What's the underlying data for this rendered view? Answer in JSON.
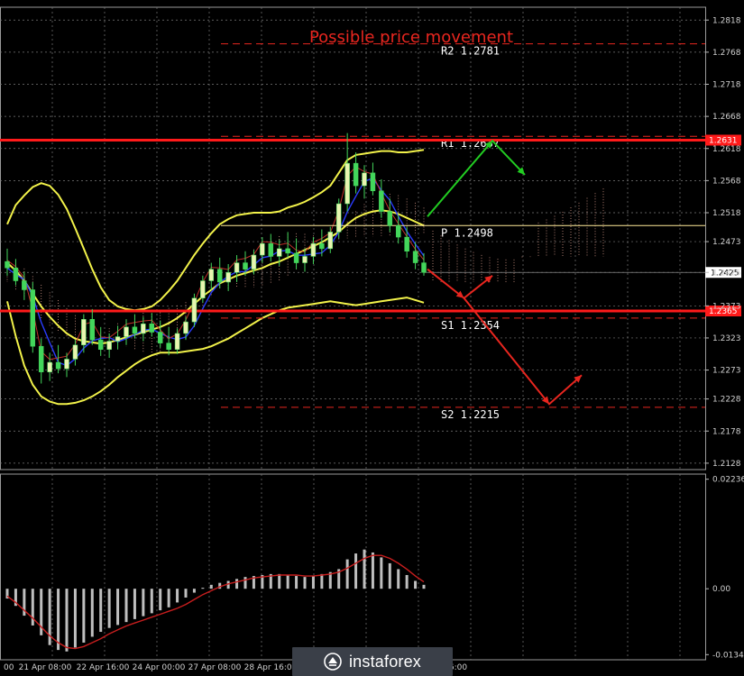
{
  "chart_data": {
    "type": "candlestick",
    "title": "Possible price movement",
    "price_axis": {
      "ylim": [
        1.2118,
        1.2838
      ],
      "tick_labels": [
        "1.2818",
        "1.2768",
        "1.2718",
        "1.2668",
        "1.2618",
        "1.2568",
        "1.2518",
        "1.2473",
        "1.2425",
        "1.2373",
        "1.2323",
        "1.2273",
        "1.2228",
        "1.2178",
        "1.2128"
      ],
      "tick_values": [
        1.2818,
        1.2768,
        1.2718,
        1.2668,
        1.2618,
        1.2568,
        1.2518,
        1.2473,
        1.2425,
        1.2373,
        1.2323,
        1.2273,
        1.2228,
        1.2178,
        1.2128
      ],
      "current_price_label": "1.2425",
      "current_price": 1.2425
    },
    "time_axis": {
      "labels": [
        "00",
        "21 Apr 08:00",
        "22 Apr 16:00",
        "24 Apr 00:00",
        "27 Apr 08:00",
        "28 Apr 16:00",
        "6:00"
      ]
    },
    "grid": true,
    "levels": [
      {
        "name": "R2",
        "label": "R2 1.2781",
        "value": 1.2781,
        "style": "dashed",
        "color": "#e8261f"
      },
      {
        "name": "R1",
        "label": "R1 1.2637",
        "value": 1.2637,
        "style": "dashed",
        "color": "#e8261f"
      },
      {
        "name": "P",
        "label": "P 1.2498",
        "value": 1.2498,
        "style": "solid",
        "color": "#ffeb99"
      },
      {
        "name": "S1",
        "label": "S1 1.2354",
        "value": 1.2354,
        "style": "dashed",
        "color": "#e8261f"
      },
      {
        "name": "S2",
        "label": "S2 1.2215",
        "value": 1.2215,
        "style": "dashed",
        "color": "#e8261f"
      }
    ],
    "resistance_line": {
      "label": "1.2631",
      "value": 1.2631,
      "color": "#ff1a1a"
    },
    "support_line": {
      "label": "1.2365",
      "value": 1.2365,
      "color": "#ff1a1a"
    },
    "candles": [
      {
        "o": 1.2442,
        "h": 1.2462,
        "l": 1.242,
        "c": 1.2432
      },
      {
        "o": 1.2432,
        "h": 1.2446,
        "l": 1.2405,
        "c": 1.2412
      },
      {
        "o": 1.2412,
        "h": 1.2426,
        "l": 1.2382,
        "c": 1.2398
      },
      {
        "o": 1.2398,
        "h": 1.241,
        "l": 1.23,
        "c": 1.231
      },
      {
        "o": 1.231,
        "h": 1.2322,
        "l": 1.2252,
        "c": 1.227
      },
      {
        "o": 1.227,
        "h": 1.23,
        "l": 1.2256,
        "c": 1.2285
      },
      {
        "o": 1.2285,
        "h": 1.2312,
        "l": 1.2268,
        "c": 1.2275
      },
      {
        "o": 1.2275,
        "h": 1.23,
        "l": 1.2262,
        "c": 1.229
      },
      {
        "o": 1.229,
        "h": 1.232,
        "l": 1.228,
        "c": 1.2312
      },
      {
        "o": 1.2312,
        "h": 1.236,
        "l": 1.23,
        "c": 1.2352
      },
      {
        "o": 1.2352,
        "h": 1.2368,
        "l": 1.2312,
        "c": 1.232
      },
      {
        "o": 1.232,
        "h": 1.234,
        "l": 1.2295,
        "c": 1.2305
      },
      {
        "o": 1.2305,
        "h": 1.233,
        "l": 1.2292,
        "c": 1.2318
      },
      {
        "o": 1.2318,
        "h": 1.2342,
        "l": 1.2305,
        "c": 1.2325
      },
      {
        "o": 1.2325,
        "h": 1.2352,
        "l": 1.2312,
        "c": 1.234
      },
      {
        "o": 1.234,
        "h": 1.236,
        "l": 1.2322,
        "c": 1.233
      },
      {
        "o": 1.233,
        "h": 1.2356,
        "l": 1.2318,
        "c": 1.2345
      },
      {
        "o": 1.2345,
        "h": 1.2362,
        "l": 1.2325,
        "c": 1.2332
      },
      {
        "o": 1.2332,
        "h": 1.235,
        "l": 1.2308,
        "c": 1.2315
      },
      {
        "o": 1.2315,
        "h": 1.234,
        "l": 1.2296,
        "c": 1.2305
      },
      {
        "o": 1.2305,
        "h": 1.2338,
        "l": 1.2298,
        "c": 1.233
      },
      {
        "o": 1.233,
        "h": 1.2356,
        "l": 1.232,
        "c": 1.2348
      },
      {
        "o": 1.2348,
        "h": 1.2392,
        "l": 1.234,
        "c": 1.2385
      },
      {
        "o": 1.2385,
        "h": 1.242,
        "l": 1.2378,
        "c": 1.2412
      },
      {
        "o": 1.2412,
        "h": 1.244,
        "l": 1.2398,
        "c": 1.243
      },
      {
        "o": 1.243,
        "h": 1.2448,
        "l": 1.24,
        "c": 1.241
      },
      {
        "o": 1.241,
        "h": 1.2438,
        "l": 1.2396,
        "c": 1.2425
      },
      {
        "o": 1.2425,
        "h": 1.2452,
        "l": 1.241,
        "c": 1.244
      },
      {
        "o": 1.244,
        "h": 1.2458,
        "l": 1.242,
        "c": 1.243
      },
      {
        "o": 1.243,
        "h": 1.246,
        "l": 1.2422,
        "c": 1.2452
      },
      {
        "o": 1.2452,
        "h": 1.248,
        "l": 1.244,
        "c": 1.247
      },
      {
        "o": 1.247,
        "h": 1.2485,
        "l": 1.2442,
        "c": 1.245
      },
      {
        "o": 1.245,
        "h": 1.2476,
        "l": 1.2435,
        "c": 1.2462
      },
      {
        "o": 1.2462,
        "h": 1.2488,
        "l": 1.2448,
        "c": 1.2455
      },
      {
        "o": 1.2455,
        "h": 1.2478,
        "l": 1.243,
        "c": 1.244
      },
      {
        "o": 1.244,
        "h": 1.2462,
        "l": 1.2426,
        "c": 1.245
      },
      {
        "o": 1.245,
        "h": 1.248,
        "l": 1.2438,
        "c": 1.247
      },
      {
        "o": 1.247,
        "h": 1.2492,
        "l": 1.245,
        "c": 1.2462
      },
      {
        "o": 1.2462,
        "h": 1.2496,
        "l": 1.2455,
        "c": 1.2488
      },
      {
        "o": 1.2488,
        "h": 1.254,
        "l": 1.2478,
        "c": 1.2532
      },
      {
        "o": 1.2532,
        "h": 1.2642,
        "l": 1.252,
        "c": 1.2595
      },
      {
        "o": 1.2595,
        "h": 1.2612,
        "l": 1.2548,
        "c": 1.256
      },
      {
        "o": 1.256,
        "h": 1.2592,
        "l": 1.254,
        "c": 1.258
      },
      {
        "o": 1.258,
        "h": 1.2596,
        "l": 1.2545,
        "c": 1.2552
      },
      {
        "o": 1.2552,
        "h": 1.257,
        "l": 1.251,
        "c": 1.252
      },
      {
        "o": 1.252,
        "h": 1.254,
        "l": 1.2488,
        "c": 1.2498
      },
      {
        "o": 1.2498,
        "h": 1.2515,
        "l": 1.247,
        "c": 1.248
      },
      {
        "o": 1.248,
        "h": 1.2496,
        "l": 1.2448,
        "c": 1.2458
      },
      {
        "o": 1.2458,
        "h": 1.2472,
        "l": 1.243,
        "c": 1.244
      },
      {
        "o": 1.244,
        "h": 1.2455,
        "l": 1.242,
        "c": 1.2425
      }
    ],
    "bollinger": {
      "upper": [
        1.25,
        1.253,
        1.2545,
        1.2558,
        1.2564,
        1.256,
        1.2546,
        1.2524,
        1.2494,
        1.2462,
        1.243,
        1.2402,
        1.2382,
        1.2372,
        1.2368,
        1.2366,
        1.2368,
        1.2372,
        1.2382,
        1.2396,
        1.2412,
        1.2432,
        1.2452,
        1.247,
        1.2486,
        1.25,
        1.2508,
        1.2514,
        1.2516,
        1.2518,
        1.2518,
        1.2518,
        1.252,
        1.2526,
        1.253,
        1.2535,
        1.2542,
        1.255,
        1.256,
        1.258,
        1.26,
        1.2608,
        1.261,
        1.2612,
        1.2614,
        1.2614,
        1.2612,
        1.2612,
        1.2614,
        1.2616
      ],
      "middle": [
        1.244,
        1.2428,
        1.2412,
        1.2392,
        1.2372,
        1.2356,
        1.2342,
        1.233,
        1.2322,
        1.2318,
        1.2316,
        1.2314,
        1.2316,
        1.232,
        1.2324,
        1.2328,
        1.2332,
        1.2336,
        1.234,
        1.2346,
        1.2354,
        1.2364,
        1.2376,
        1.2388,
        1.2398,
        1.2408,
        1.2414,
        1.242,
        1.2424,
        1.2428,
        1.2432,
        1.2438,
        1.2442,
        1.2448,
        1.2454,
        1.246,
        1.2466,
        1.2472,
        1.248,
        1.2488,
        1.25,
        1.251,
        1.2516,
        1.252,
        1.2522,
        1.252,
        1.2516,
        1.251,
        1.2504,
        1.2498
      ],
      "lower": [
        1.238,
        1.2326,
        1.228,
        1.225,
        1.2232,
        1.2224,
        1.222,
        1.222,
        1.2222,
        1.2226,
        1.2232,
        1.224,
        1.225,
        1.2262,
        1.2272,
        1.2282,
        1.229,
        1.2296,
        1.23,
        1.23,
        1.23,
        1.2302,
        1.2304,
        1.2306,
        1.231,
        1.2316,
        1.2322,
        1.233,
        1.2338,
        1.2346,
        1.2354,
        1.236,
        1.2366,
        1.237,
        1.2372,
        1.2374,
        1.2376,
        1.2378,
        1.238,
        1.2378,
        1.2376,
        1.2374,
        1.2376,
        1.2378,
        1.238,
        1.2382,
        1.2384,
        1.2386,
        1.2382,
        1.2378
      ]
    },
    "macd": {
      "ylim": [
        -0.0145,
        0.0234
      ],
      "tick_labels": [
        "0.02236",
        "0.00",
        "-0.01345"
      ],
      "tick_values": [
        0.02236,
        0.0,
        -0.01345
      ],
      "histogram": [
        -0.002,
        -0.0035,
        -0.0055,
        -0.0075,
        -0.0095,
        -0.0115,
        -0.0125,
        -0.0128,
        -0.012,
        -0.011,
        -0.0098,
        -0.0088,
        -0.008,
        -0.0074,
        -0.0068,
        -0.0062,
        -0.0056,
        -0.005,
        -0.0044,
        -0.0038,
        -0.0028,
        -0.0018,
        -0.0008,
        0.0002,
        0.0008,
        0.0012,
        0.0016,
        0.002,
        0.0024,
        0.0026,
        0.0028,
        0.003,
        0.003,
        0.0028,
        0.0026,
        0.0024,
        0.0026,
        0.003,
        0.0034,
        0.004,
        0.006,
        0.0072,
        0.008,
        0.0074,
        0.0064,
        0.0052,
        0.004,
        0.0028,
        0.0016,
        0.0008
      ],
      "signal": [
        -0.0015,
        -0.0028,
        -0.0044,
        -0.006,
        -0.0078,
        -0.0096,
        -0.011,
        -0.012,
        -0.0122,
        -0.0118,
        -0.011,
        -0.0102,
        -0.0092,
        -0.0084,
        -0.0076,
        -0.007,
        -0.0064,
        -0.0058,
        -0.0052,
        -0.0046,
        -0.004,
        -0.0032,
        -0.0022,
        -0.0012,
        -0.0004,
        0.0004,
        0.001,
        0.0014,
        0.0018,
        0.0022,
        0.0024,
        0.0026,
        0.0028,
        0.0028,
        0.0028,
        0.0026,
        0.0026,
        0.0028,
        0.003,
        0.0034,
        0.0042,
        0.0052,
        0.0062,
        0.0068,
        0.0068,
        0.0062,
        0.0052,
        0.004,
        0.0026,
        0.0014
      ]
    },
    "forecast_arrows": [
      {
        "name": "bull-path",
        "color": "#22cc22",
        "points": [
          [
            0,
            1.2512
          ],
          [
            8,
            1.263
          ],
          [
            12,
            1.2577
          ]
        ]
      },
      {
        "name": "bear-pullback-path",
        "color": "#e8261f",
        "points": [
          [
            0,
            1.243
          ],
          [
            4.5,
            1.2385
          ],
          [
            8,
            1.242
          ]
        ]
      },
      {
        "name": "bear-path",
        "color": "#e8261f",
        "points": [
          [
            4.5,
            1.2385
          ],
          [
            15,
            1.222
          ],
          [
            19,
            1.2265
          ]
        ]
      }
    ],
    "colors": {
      "bull_candle": "#e8f5b0",
      "bear_candle": "#43d65b",
      "bollinger": "#f2f24a",
      "middle_band": "#f2f24a",
      "macd_histogram": "#bfbfbf",
      "macd_signal": "#c81e1e",
      "grid": "#7a7a7a",
      "background": "#000000"
    }
  },
  "watermark": {
    "text": "instaforex"
  }
}
